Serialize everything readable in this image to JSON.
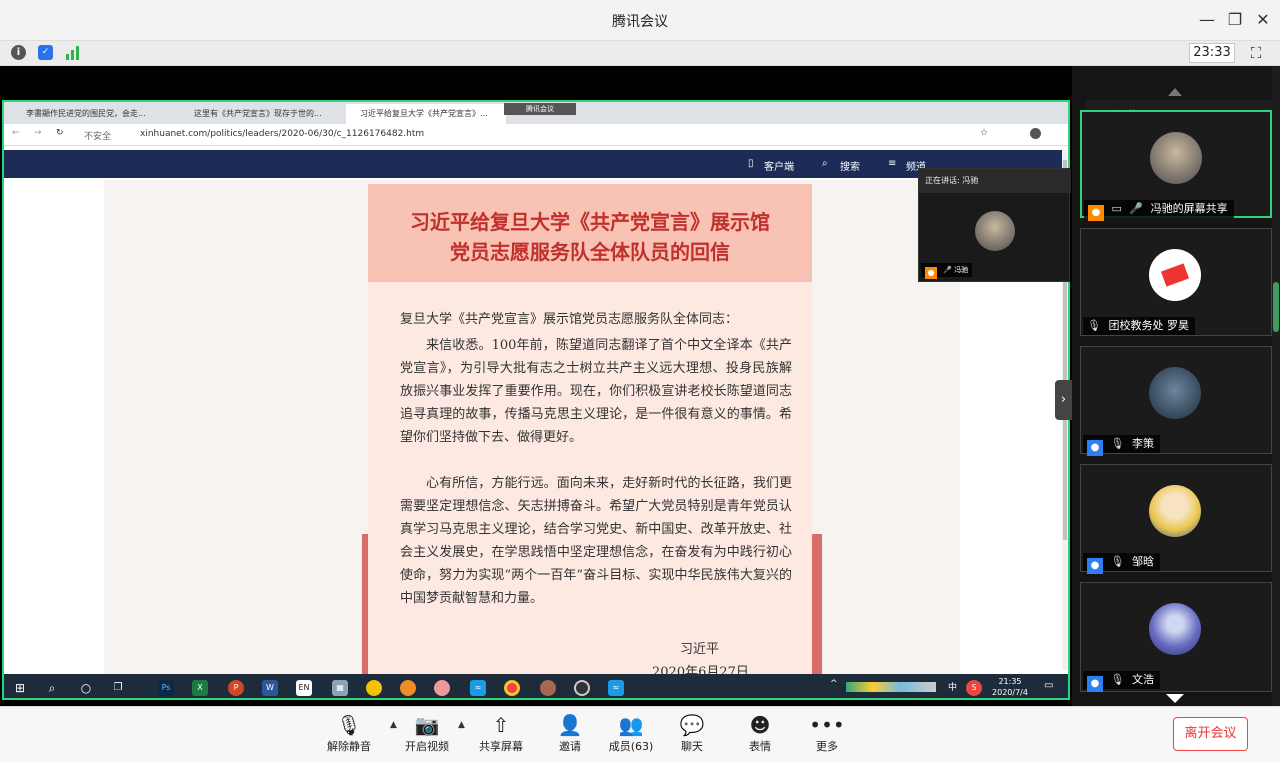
{
  "app": {
    "title": "腾讯会议",
    "time": "23:33",
    "window_controls": {
      "minimize": "—",
      "restore": "❐",
      "close": "✕"
    }
  },
  "infobar": {
    "icons": [
      "info-icon",
      "shield-icon",
      "signal-icon"
    ],
    "fullscreen": "⛶"
  },
  "shared_screen": {
    "browser_tabs": [
      {
        "label": "李書顯作民进党的围民党，会走..."
      },
      {
        "label": "这里有《共产党宣言》现存于世的..."
      },
      {
        "label": "习近平给复旦大学《共产党宣言》..."
      }
    ],
    "overlay_badge": "腾讯会议",
    "url_security": "不安全",
    "url": "xinhuanet.com/politics/leaders/2020-06/30/c_1126176482.htm",
    "site_nav": {
      "client": "客户端",
      "search": "搜索",
      "menu": "频道"
    },
    "letter": {
      "title_line1": "习近平给复旦大学《共产党宣言》展示馆",
      "title_line2": "党员志愿服务队全体队员的回信",
      "salutation": "复旦大学《共产党宣言》展示馆党员志愿服务队全体同志：",
      "para1": "来信收悉。100年前，陈望道同志翻译了首个中文全译本《共产党宣言》，为引导大批有志之士树立共产主义远大理想、投身民族解放振兴事业发挥了重要作用。现在，你们积极宣讲老校长陈望道同志追寻真理的故事，传播马克思主义理论，是一件很有意义的事情。希望你们坚持做下去、做得更好。",
      "para2": "心有所信，方能行远。面向未来，走好新时代的长征路，我们更需要坚定理想信念、矢志拼搏奋斗。希望广大党员特别是青年党员认真学习马克思主义理论，结合学习党史、新中国史、改革开放史、社会主义发展史，在学思践悟中坚定理想信念，在奋发有为中践行初心使命，努力为实现“两个一百年”奋斗目标、实现中华民族伟大复兴的中国梦贡献智慧和力量。",
      "signature": "习近平",
      "date": "2020年6月27日"
    },
    "taskbar": {
      "time": "21:35",
      "date": "2020/7/4",
      "ime": "中"
    },
    "mini_window": {
      "header": "正在讲话: 冯驰",
      "name": "冯驰"
    }
  },
  "panel": {
    "speaking": "正在讲话: 冯驰",
    "participants": [
      {
        "name": "冯驰的屏幕共享",
        "active": true
      },
      {
        "name": "团校教务处 罗昊",
        "active": false
      },
      {
        "name": "李策",
        "active": false
      },
      {
        "name": "邹晗",
        "active": false
      },
      {
        "name": "文浩",
        "active": false
      }
    ]
  },
  "toolbar": {
    "unmute": "解除静音",
    "start_video": "开启视频",
    "share_screen": "共享屏幕",
    "invite": "邀请",
    "members": "成员(63)",
    "chat": "聊天",
    "reactions": "表情",
    "more": "更多",
    "leave": "离开会议"
  },
  "colors": {
    "active_border": "#2fd37a",
    "leave_red": "#e33333",
    "letter_title": "#c0302c",
    "site_header": "#1d2c57"
  }
}
